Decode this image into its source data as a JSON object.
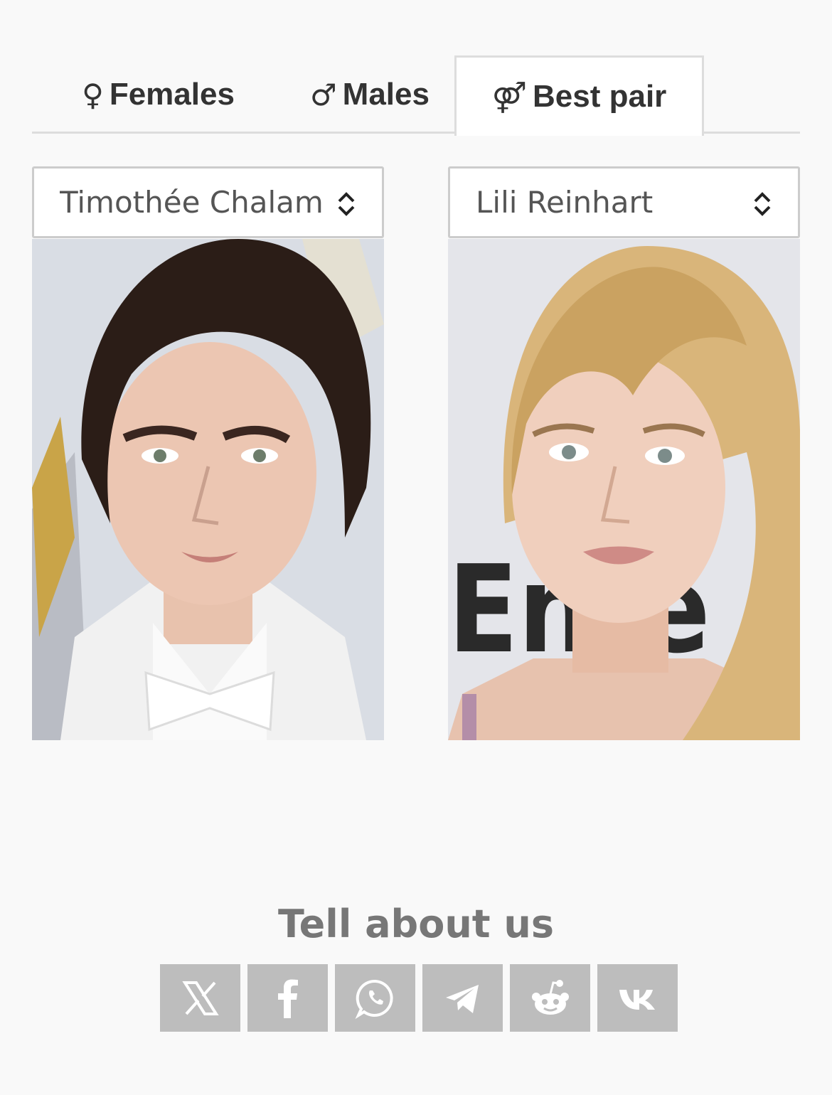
{
  "tabs": [
    {
      "symbol": "♀",
      "label": "Females"
    },
    {
      "symbol": "♂",
      "label": "Males"
    },
    {
      "symbol": "⚤",
      "label": "Best pair",
      "active": true
    }
  ],
  "selects": {
    "left": {
      "value": "Timothée Chalamet"
    },
    "right": {
      "value": "Lili Reinhart"
    }
  },
  "share": {
    "title": "Tell about us",
    "buttons": [
      "x-icon",
      "facebook-icon",
      "whatsapp-icon",
      "telegram-icon",
      "reddit-icon",
      "vk-icon"
    ]
  },
  "colors": {
    "background": "#f9f9f9",
    "tab_border": "#dddddd",
    "share_button": "#bdbdbd",
    "share_title": "#777777"
  }
}
